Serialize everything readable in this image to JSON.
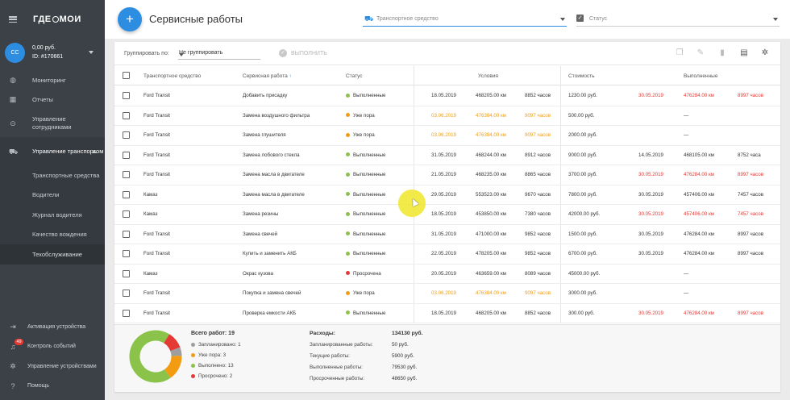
{
  "brand": {
    "logo_text_left": "ГДЕ",
    "logo_text_right": "МОИ"
  },
  "account": {
    "initials": "СС",
    "balance": "0,00 руб.",
    "id": "ID: #170661"
  },
  "nav": {
    "items": [
      {
        "label": "Мониторинг",
        "icon": "globe-icon"
      },
      {
        "label": "Отчеты",
        "icon": "report-icon"
      },
      {
        "label": "Управление сотрудниками",
        "icon": "location-icon"
      },
      {
        "label": "Управление транспортом",
        "icon": "car-icon"
      }
    ],
    "sub_items": [
      "Транспортные средства",
      "Водители",
      "Журнал водителя",
      "Качество вождения",
      "Техобслуживание"
    ],
    "bottom": [
      {
        "label": "Активация устройства",
        "icon": "login-icon"
      },
      {
        "label": "Контроль событий",
        "icon": "bell-icon",
        "badge": "49"
      },
      {
        "label": "Управление устройствами",
        "icon": "gear-icon"
      },
      {
        "label": "Помощь",
        "icon": "help-icon"
      }
    ]
  },
  "header": {
    "title": "Сервисные работы",
    "vehicle_placeholder": "Транспортное средство",
    "status_placeholder": "Статус"
  },
  "toolbar": {
    "group_label": "Группировать по:",
    "group_value": "Не группировать",
    "execute_label": "ВЫПОЛНИТЬ"
  },
  "table": {
    "headers": {
      "vehicle": "Транспортное средство",
      "service": "Сервисная работа",
      "status": "Статус",
      "conditions": "Условия",
      "cost": "Стоимость",
      "done": "Выполненные"
    },
    "rows": [
      {
        "vehicle": "Ford Transit",
        "service": "Добавить присадку",
        "status": "Выполненные",
        "status_color": "#8bc34a",
        "cond_date": "18.05.2019",
        "cond_km": "468205.00 км",
        "cond_hours": "8852 часов",
        "cond_color": "#333333",
        "cost": "1230.00 руб.",
        "done_date": "30.05.2019",
        "done_km": "476284.00 км",
        "done_hours": "8997 часов",
        "done_color": "#e53935"
      },
      {
        "vehicle": "Ford Transit",
        "service": "Замена воздушного фильтра",
        "status": "Уже пора",
        "status_color": "#f39c12",
        "cond_date": "03.06.2019",
        "cond_km": "476384.00 км",
        "cond_hours": "9097 часов",
        "cond_color": "#f39c12",
        "cost": "500.00 руб.",
        "done_date": "",
        "done_km": "—",
        "done_hours": "",
        "done_color": "#333333"
      },
      {
        "vehicle": "Ford Transit",
        "service": "Замена глушителя",
        "status": "Уже пора",
        "status_color": "#f39c12",
        "cond_date": "03.06.2019",
        "cond_km": "476384.00 км",
        "cond_hours": "9097 часов",
        "cond_color": "#f39c12",
        "cost": "2000.00 руб.",
        "done_date": "",
        "done_km": "—",
        "done_hours": "",
        "done_color": "#333333"
      },
      {
        "vehicle": "Ford Transit",
        "service": "Замена лобового стекла",
        "status": "Выполненные",
        "status_color": "#8bc34a",
        "cond_date": "31.05.2019",
        "cond_km": "468244.00 км",
        "cond_hours": "8912 часов",
        "cond_color": "#333333",
        "cost": "9000.00 руб.",
        "done_date": "14.05.2019",
        "done_km": "468105.00 км",
        "done_hours": "8752 часа",
        "done_color": "#333333"
      },
      {
        "vehicle": "Ford Transit",
        "service": "Замена масла в двигателе",
        "status": "Выполненные",
        "status_color": "#8bc34a",
        "cond_date": "21.05.2019",
        "cond_km": "468235.00 км",
        "cond_hours": "8865 часов",
        "cond_color": "#333333",
        "cost": "3700.00 руб.",
        "done_date": "30.05.2019",
        "done_km": "476284.00 км",
        "done_hours": "8997 часов",
        "done_color": "#e53935"
      },
      {
        "vehicle": "Камаз",
        "service": "Замена масла в двигателе",
        "status": "Выполненные",
        "status_color": "#8bc34a",
        "cond_date": "29.05.2019",
        "cond_km": "553523.00 км",
        "cond_hours": "9670 часов",
        "cond_color": "#333333",
        "cost": "7800.00 руб.",
        "done_date": "30.05.2019",
        "done_km": "457406.00 км",
        "done_hours": "7457 часов",
        "done_color": "#333333"
      },
      {
        "vehicle": "Камаз",
        "service": "Замена резины",
        "status": "Выполненные",
        "status_color": "#8bc34a",
        "cond_date": "18.05.2019",
        "cond_km": "453850.00 км",
        "cond_hours": "7380 часов",
        "cond_color": "#333333",
        "cost": "42000.00 руб.",
        "done_date": "30.05.2019",
        "done_km": "457406.00 км",
        "done_hours": "7457 часов",
        "done_color": "#e53935"
      },
      {
        "vehicle": "Ford Transit",
        "service": "Замена свечей",
        "status": "Выполненные",
        "status_color": "#8bc34a",
        "cond_date": "31.05.2019",
        "cond_km": "471000.00 км",
        "cond_hours": "9852 часов",
        "cond_color": "#333333",
        "cost": "1500.00 руб.",
        "done_date": "30.05.2019",
        "done_km": "476284.00 км",
        "done_hours": "8997 часов",
        "done_color": "#333333"
      },
      {
        "vehicle": "Ford Transit",
        "service": "Купить и заменить АКБ",
        "status": "Выполненные",
        "status_color": "#8bc34a",
        "cond_date": "22.05.2019",
        "cond_km": "478205.00 км",
        "cond_hours": "9852 часов",
        "cond_color": "#333333",
        "cost": "6700.00 руб.",
        "done_date": "30.05.2019",
        "done_km": "476284.00 км",
        "done_hours": "8997 часов",
        "done_color": "#333333"
      },
      {
        "vehicle": "Камаз",
        "service": "Окрас кузова",
        "status": "Просрочена",
        "status_color": "#e53935",
        "cond_date": "20.05.2019",
        "cond_km": "463659.00 км",
        "cond_hours": "8089 часов",
        "cond_color": "#333333",
        "cost": "45000.00 руб.",
        "done_date": "",
        "done_km": "—",
        "done_hours": "",
        "done_color": "#333333"
      },
      {
        "vehicle": "Ford Transit",
        "service": "Покупка и замена свечей",
        "status": "Уже пора",
        "status_color": "#f39c12",
        "cond_date": "03.06.2019",
        "cond_km": "476384.00 км",
        "cond_hours": "9097 часов",
        "cond_color": "#f39c12",
        "cost": "3000.00 руб.",
        "done_date": "",
        "done_km": "—",
        "done_hours": "",
        "done_color": "#333333"
      },
      {
        "vehicle": "Ford Transit",
        "service": "Проверка емкости АКБ",
        "status": "Выполненные",
        "status_color": "#8bc34a",
        "cond_date": "18.05.2019",
        "cond_km": "468205.00 км",
        "cond_hours": "8852 часов",
        "cond_color": "#333333",
        "cost": "300.00 руб.",
        "done_date": "30.05.2019",
        "done_km": "476284.00 км",
        "done_hours": "8997 часов",
        "done_color": "#e53935"
      }
    ]
  },
  "summary": {
    "total": "Всего работ: 19",
    "legend": [
      {
        "label": "Запланировано: 1",
        "color": "#9e9e9e",
        "value": 1
      },
      {
        "label": "Уже пора: 3",
        "color": "#f39c12",
        "value": 3
      },
      {
        "label": "Выполнено: 13",
        "color": "#8bc34a",
        "value": 13
      },
      {
        "label": "Просрочено: 2",
        "color": "#e53935",
        "value": 2
      }
    ],
    "expenses": [
      {
        "label": "Расходы:",
        "value": "134130 руб."
      },
      {
        "label": "Запланированные работы:",
        "value": "50 руб."
      },
      {
        "label": "Текущие работы:",
        "value": "5900 руб."
      },
      {
        "label": "Выполненные работы:",
        "value": "79530 руб."
      },
      {
        "label": "Просроченные работы:",
        "value": "48650 руб."
      }
    ]
  },
  "colors": {
    "accent": "#2d8de0",
    "sidebar": "#3b4147"
  }
}
